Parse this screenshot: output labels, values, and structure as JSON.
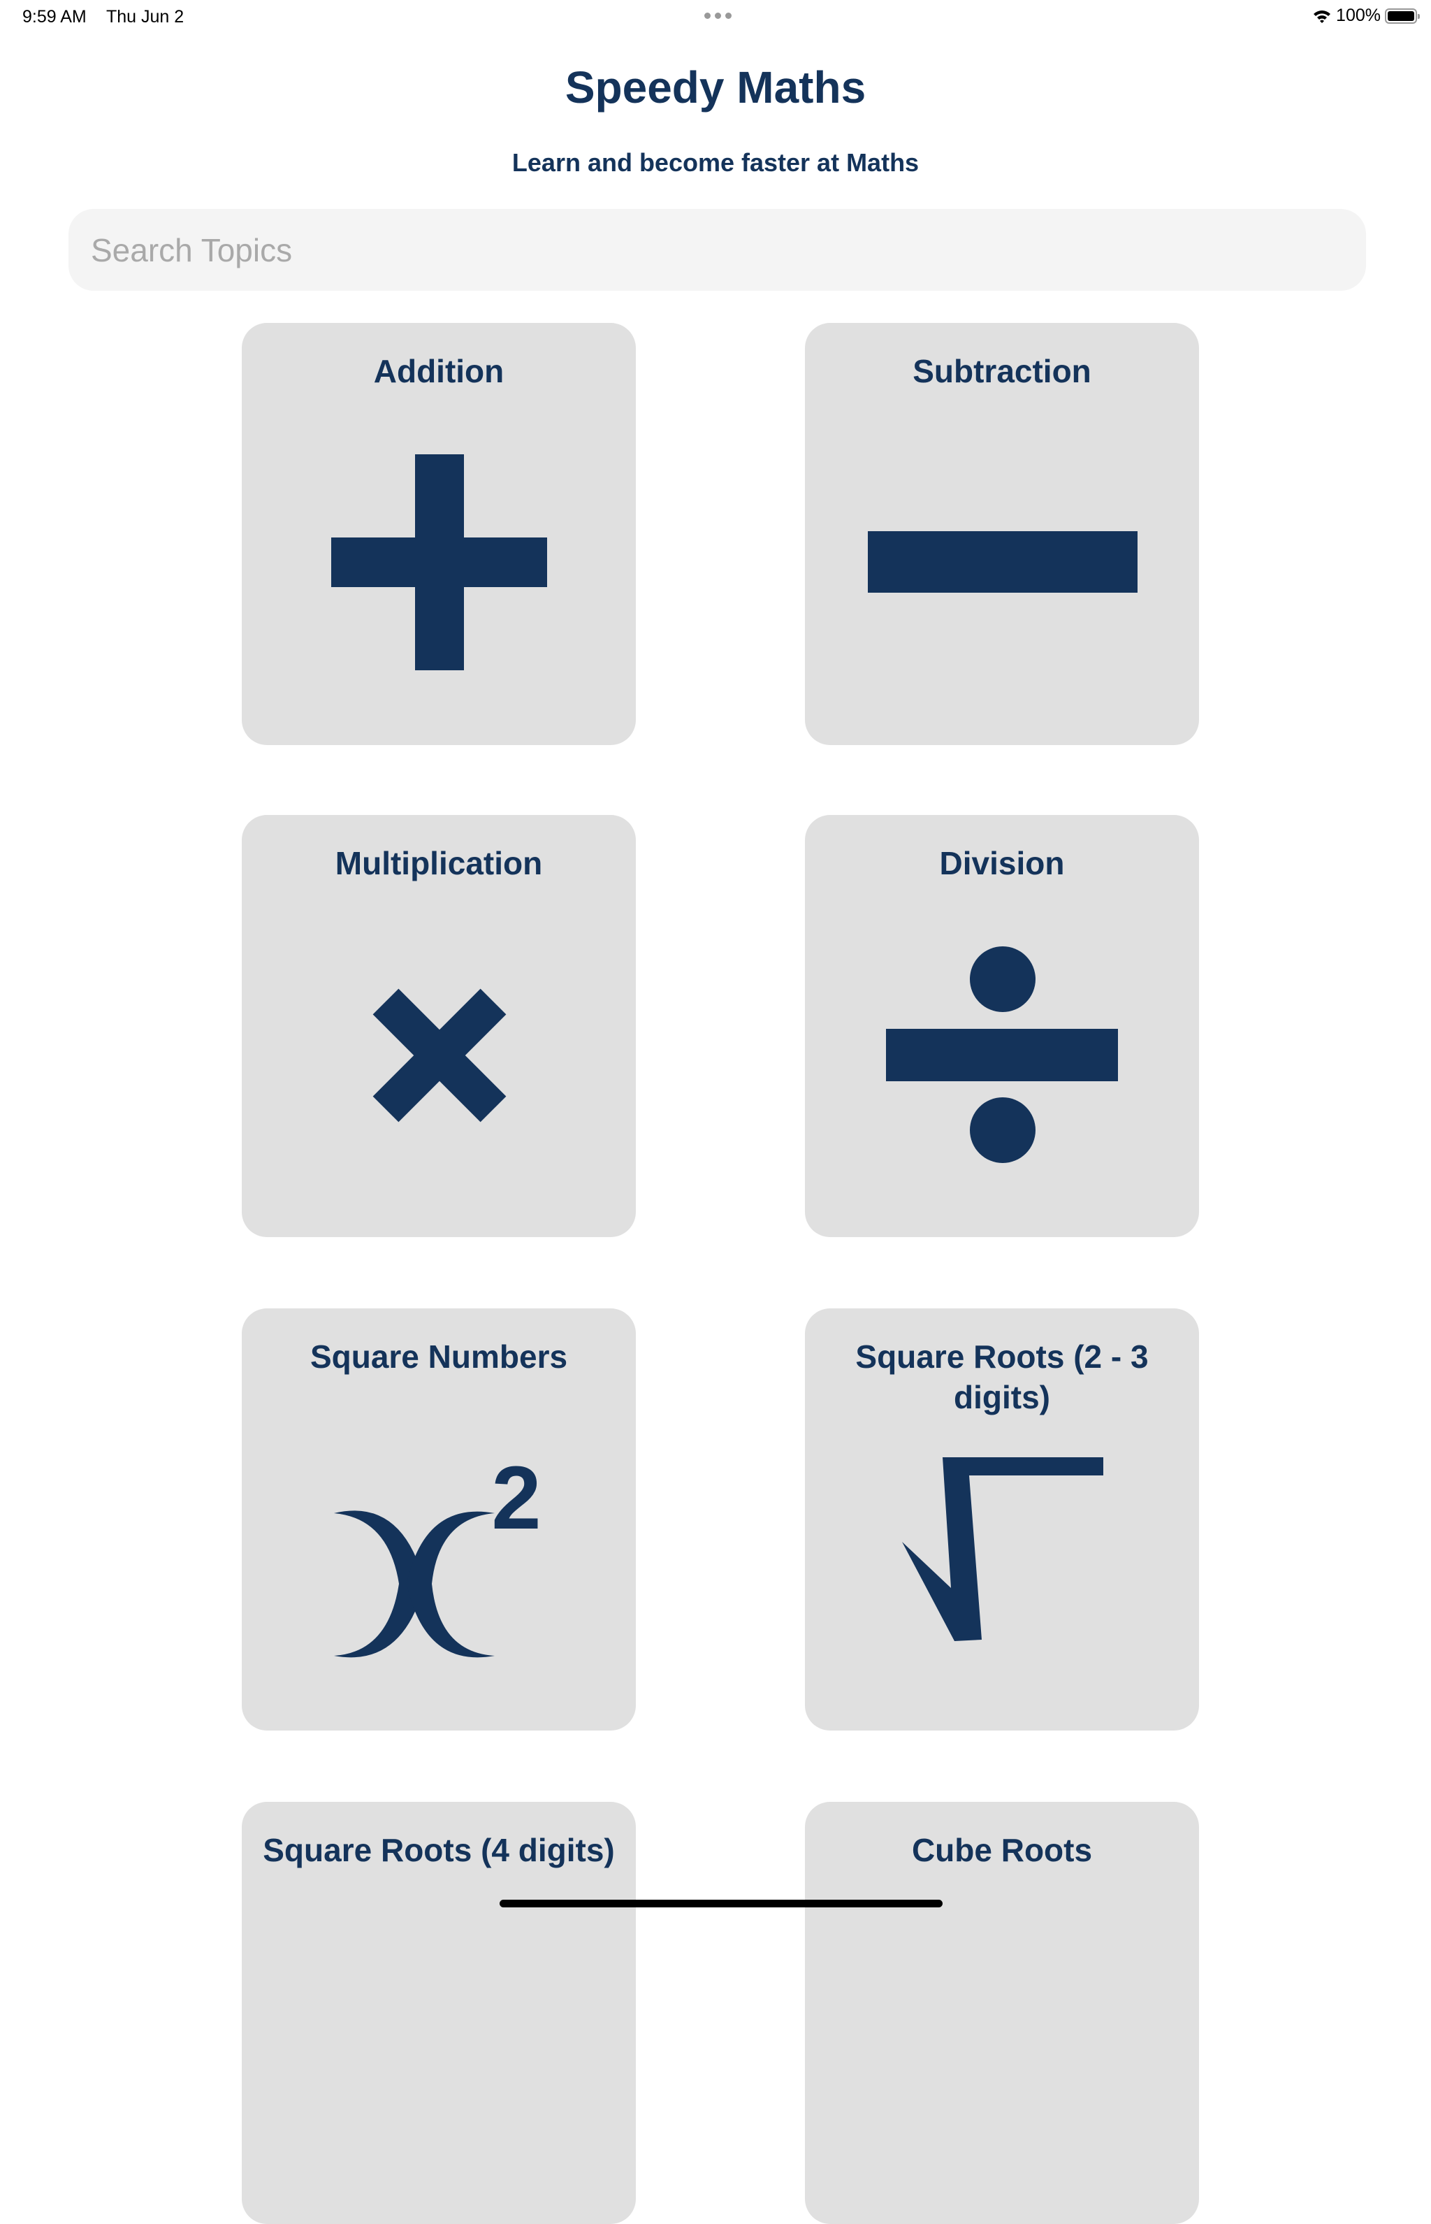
{
  "status_bar": {
    "time": "9:59 AM",
    "date": "Thu Jun 2",
    "battery": "100%",
    "battery_level": 100
  },
  "header": {
    "title": "Speedy Maths",
    "subtitle": "Learn and become faster at Maths"
  },
  "search": {
    "placeholder": "Search Topics",
    "value": ""
  },
  "colors": {
    "accent": "#14335a",
    "card_bg": "#e0e0e0",
    "search_bg": "#f4f4f4"
  },
  "topics": [
    {
      "label": "Addition",
      "icon": "plus-icon"
    },
    {
      "label": "Subtraction",
      "icon": "minus-icon"
    },
    {
      "label": "Multiplication",
      "icon": "multiply-icon"
    },
    {
      "label": "Division",
      "icon": "divide-icon"
    },
    {
      "label": "Square Numbers",
      "icon": "x-squared-icon",
      "icon_text": "2"
    },
    {
      "label": "Square Roots (2 - 3 digits)",
      "icon": "square-root-icon"
    },
    {
      "label": "Square Roots (4 digits)"
    },
    {
      "label": "Cube Roots"
    }
  ]
}
